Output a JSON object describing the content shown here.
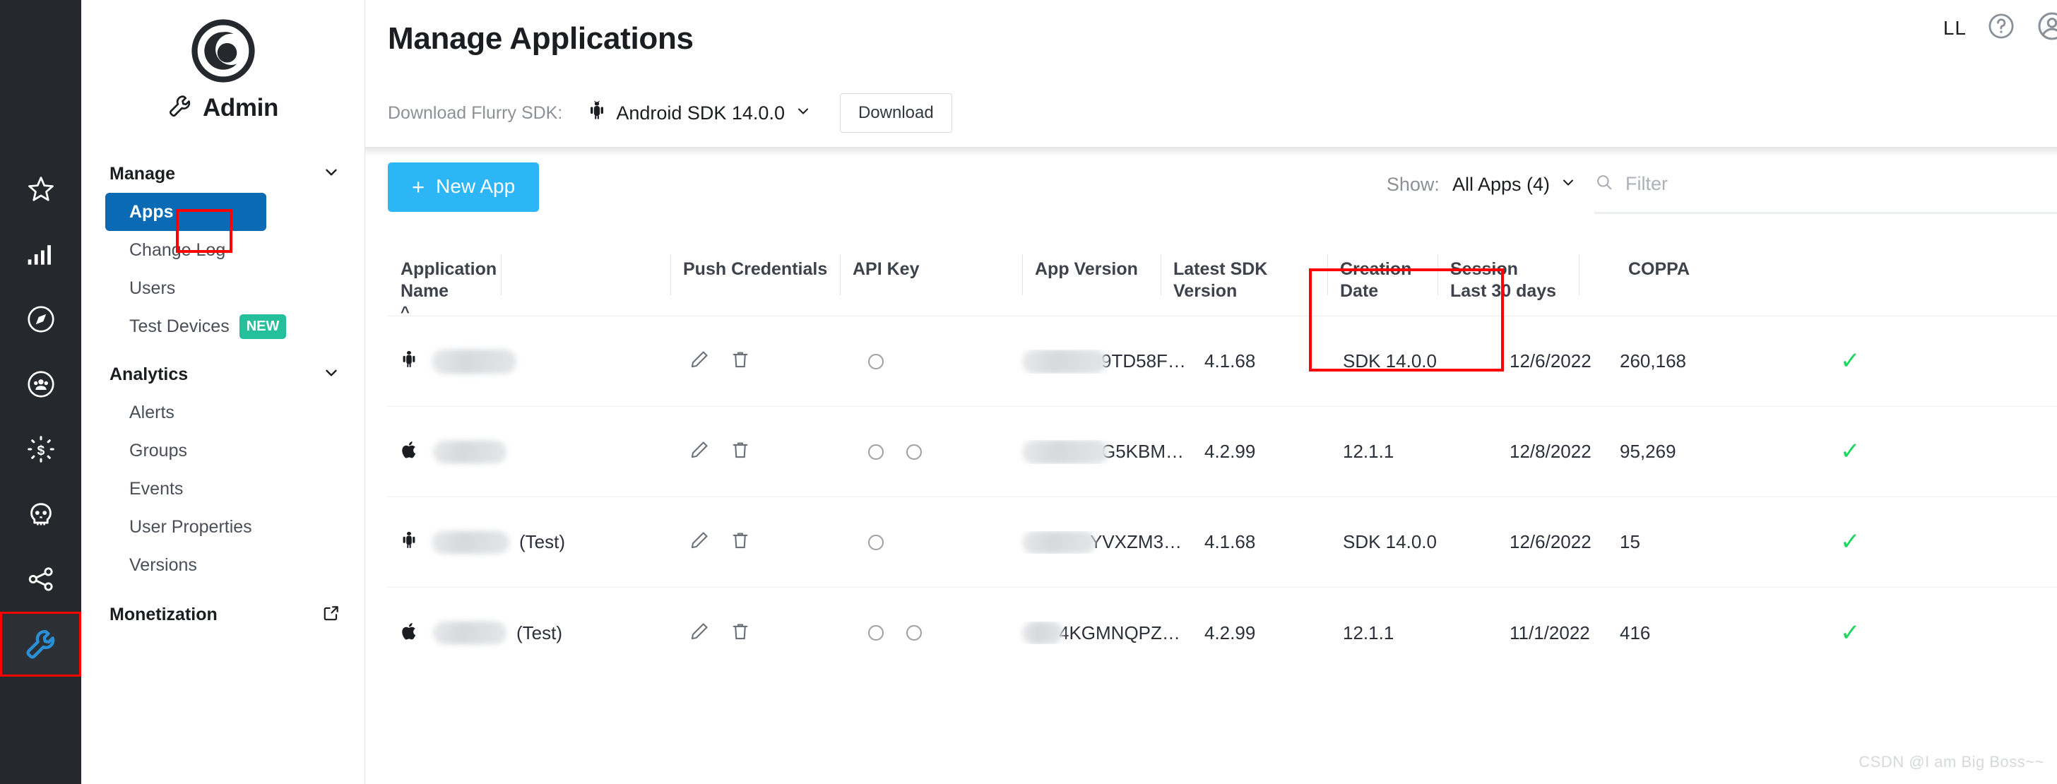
{
  "rail": {
    "items": [
      {
        "name": "star-icon",
        "label": "Favorites"
      },
      {
        "name": "bar-chart-icon",
        "label": "Analytics"
      },
      {
        "name": "compass-icon",
        "label": "Explorer"
      },
      {
        "name": "audience-icon",
        "label": "Audience"
      },
      {
        "name": "monetization-icon",
        "label": "Monetization"
      },
      {
        "name": "crash-icon",
        "label": "Crash"
      },
      {
        "name": "share-icon",
        "label": "Share"
      },
      {
        "name": "wrench-icon",
        "label": "Admin"
      }
    ],
    "active_index": 7
  },
  "sidebar": {
    "brand": "Admin",
    "groups": [
      {
        "title": "Manage",
        "items": [
          {
            "label": "Apps",
            "selected": true,
            "badge": ""
          },
          {
            "label": "Change Log",
            "selected": false,
            "badge": ""
          },
          {
            "label": "Users",
            "selected": false,
            "badge": ""
          },
          {
            "label": "Test Devices",
            "selected": false,
            "badge": "NEW"
          }
        ]
      },
      {
        "title": "Analytics",
        "items": [
          {
            "label": "Alerts",
            "selected": false,
            "badge": ""
          },
          {
            "label": "Groups",
            "selected": false,
            "badge": ""
          },
          {
            "label": "Events",
            "selected": false,
            "badge": ""
          },
          {
            "label": "User Properties",
            "selected": false,
            "badge": ""
          },
          {
            "label": "Versions",
            "selected": false,
            "badge": ""
          }
        ]
      }
    ],
    "external": {
      "label": "Monetization"
    }
  },
  "header": {
    "title": "Manage Applications",
    "sdk_label": "Download Flurry SDK:",
    "sdk_value": "Android SDK 14.0.0",
    "download_button": "Download",
    "user_initials": "LL"
  },
  "toolbar": {
    "new_app_label": "New App",
    "new_app_plus": "+",
    "show_label": "Show:",
    "show_value": "All Apps (4)",
    "filter_placeholder": "Filter",
    "filter_value": ""
  },
  "table": {
    "columns": [
      {
        "label": "Application Name",
        "sort": "^"
      },
      {
        "label": ""
      },
      {
        "label": "Push Credentials"
      },
      {
        "label": "API Key"
      },
      {
        "label": "App Version"
      },
      {
        "label": "Latest SDK Version"
      },
      {
        "label": "Creation\nDate",
        "line1": "Creation",
        "line2": "Date"
      },
      {
        "label": "Session\nLast 30 days",
        "line1": "Session",
        "line2": "Last 30 days"
      },
      {
        "label": "COPPA"
      }
    ],
    "rows": [
      {
        "platform": "android",
        "name_redacted": true,
        "name_suffix": "",
        "push_slots": 1,
        "api_key": "9TD58F…",
        "app_version": "4.1.68",
        "latest_sdk_version": "SDK 14.0.0",
        "creation_date": "12/6/2022",
        "sessions_last_30_days": "260,168",
        "coppa": "✓"
      },
      {
        "platform": "ios",
        "name_redacted": true,
        "name_suffix": "",
        "push_slots": 2,
        "api_key": "G5KBM…",
        "app_version": "4.2.99",
        "latest_sdk_version": "12.1.1",
        "creation_date": "12/8/2022",
        "sessions_last_30_days": "95,269",
        "coppa": "✓"
      },
      {
        "platform": "android",
        "name_redacted": true,
        "name_suffix": "(Test)",
        "push_slots": 1,
        "api_key": "YVXZM3…",
        "app_version": "4.1.68",
        "latest_sdk_version": "SDK 14.0.0",
        "creation_date": "12/6/2022",
        "sessions_last_30_days": "15",
        "coppa": "✓"
      },
      {
        "platform": "ios",
        "name_redacted": true,
        "name_suffix": "(Test)",
        "push_slots": 2,
        "api_key": "4KGMNQPZ…",
        "app_version": "4.2.99",
        "latest_sdk_version": "12.1.1",
        "creation_date": "11/1/2022",
        "sessions_last_30_days": "416",
        "coppa": "✓"
      }
    ]
  },
  "annotations": {
    "highlight_color": "#fe0000",
    "apps_highlight": "Apps",
    "api_key_highlight": "API Key",
    "admin_icon_highlight": "wrench-icon"
  },
  "colors": {
    "rail_bg": "#25282c",
    "selected_nav": "#0a6ab4",
    "primary_button": "#2cb6f6",
    "badge_new": "#25bf9c",
    "check_green": "#1ed760",
    "accent_red": "#fe0000",
    "admin_icon_blue": "#2b8fd6"
  },
  "watermark": "CSDN @I am Big Boss~~"
}
